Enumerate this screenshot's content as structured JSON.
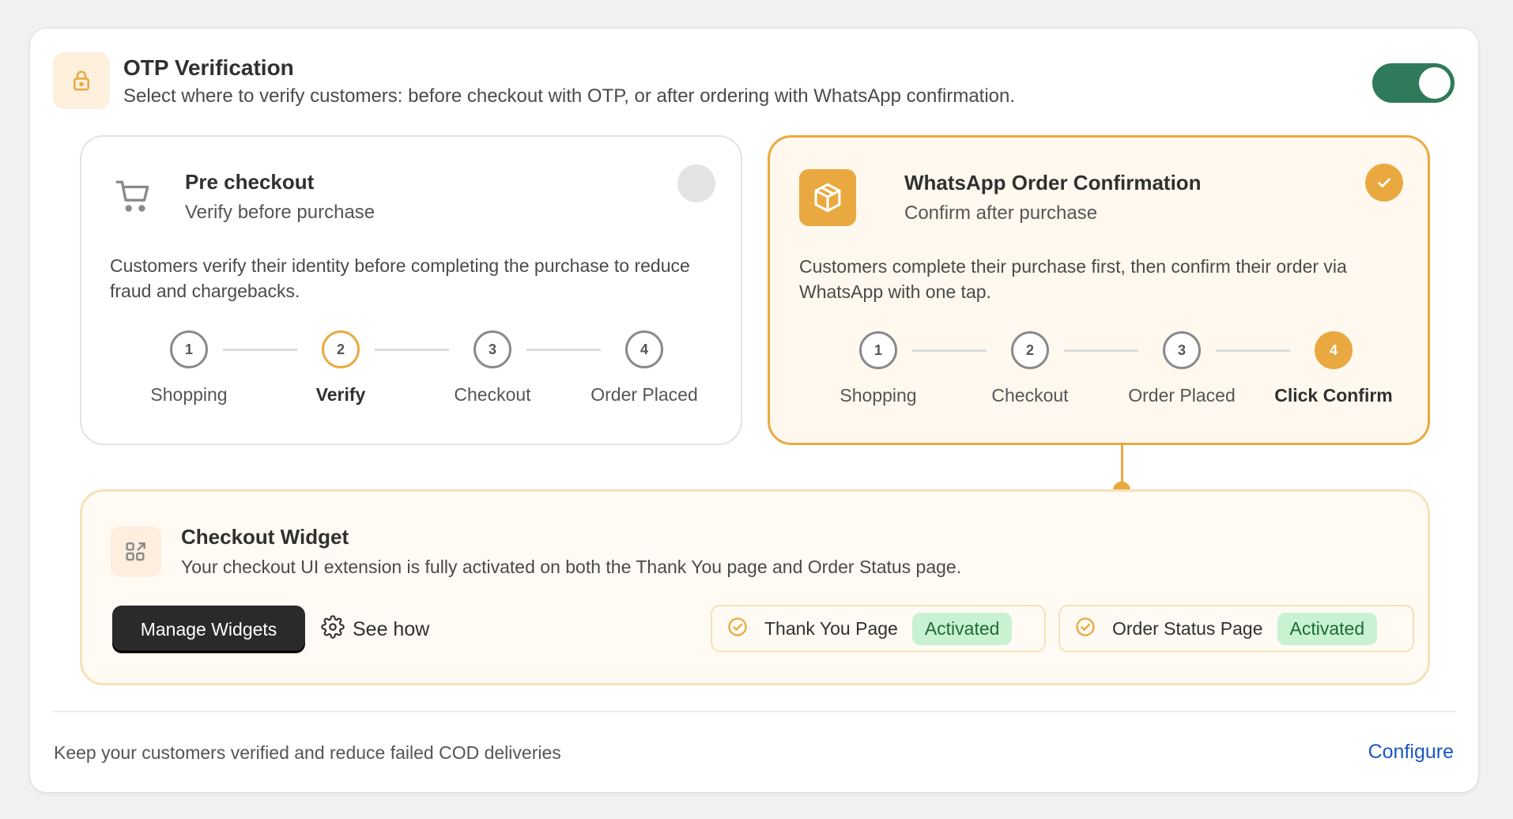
{
  "header": {
    "title": "OTP Verification",
    "description": "Select where to verify customers: before checkout with OTP, or after ordering with WhatsApp confirmation.",
    "icon": "lock-icon",
    "toggle_on": true
  },
  "options": [
    {
      "id": "pre_checkout",
      "icon": "cart-icon",
      "title": "Pre checkout",
      "subtitle": "Verify before purchase",
      "body": "Customers verify their identity before completing the purchase to reduce fraud and chargebacks.",
      "selected": false,
      "steps": [
        {
          "num": "1",
          "label": "Shopping",
          "state": "default"
        },
        {
          "num": "2",
          "label": "Verify",
          "state": "current"
        },
        {
          "num": "3",
          "label": "Checkout",
          "state": "default"
        },
        {
          "num": "4",
          "label": "Order Placed",
          "state": "default"
        }
      ]
    },
    {
      "id": "whatsapp_confirmation",
      "icon": "package-icon",
      "title": "WhatsApp Order Confirmation",
      "subtitle": "Confirm after purchase",
      "body": "Customers complete their purchase first, then confirm their order via WhatsApp with one tap.",
      "selected": true,
      "steps": [
        {
          "num": "1",
          "label": "Shopping",
          "state": "default"
        },
        {
          "num": "2",
          "label": "Checkout",
          "state": "default"
        },
        {
          "num": "3",
          "label": "Order Placed",
          "state": "default"
        },
        {
          "num": "4",
          "label": "Click Confirm",
          "state": "done"
        }
      ]
    }
  ],
  "widget": {
    "icon": "widget-grid-icon",
    "title": "Checkout Widget",
    "description": "Your checkout UI extension is fully activated on both the Thank You page and Order Status page.",
    "manage_button": "Manage Widgets",
    "see_how": "See how",
    "statuses": [
      {
        "label": "Thank You Page",
        "badge": "Activated"
      },
      {
        "label": "Order Status Page",
        "badge": "Activated"
      }
    ]
  },
  "footer": {
    "text": "Keep your customers verified and reduce failed COD deliveries",
    "link": "Configure"
  },
  "colors": {
    "accent": "#eaa940",
    "toggle_on": "#2f7a5a",
    "badge_bg": "#c8f2d2",
    "link": "#1a57c4"
  }
}
